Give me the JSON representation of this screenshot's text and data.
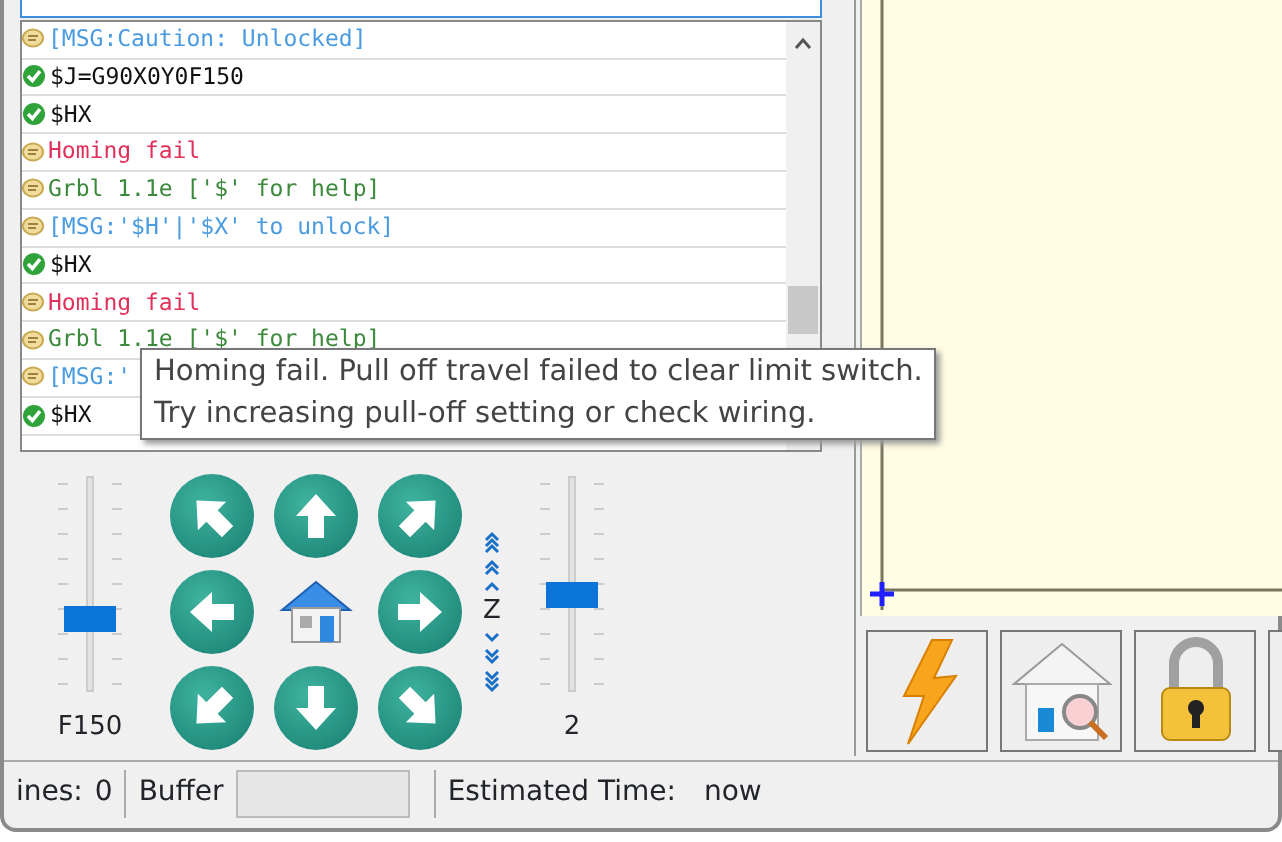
{
  "console": {
    "rows": [
      {
        "kind": "msg",
        "text": "[MSG:Caution: Unlocked]"
      },
      {
        "kind": "ok",
        "text": "$J=G90X0Y0F150"
      },
      {
        "kind": "ok",
        "text": "$HX"
      },
      {
        "kind": "error",
        "text": "Homing fail"
      },
      {
        "kind": "info",
        "text": "Grbl 1.1e ['$' for help]"
      },
      {
        "kind": "msg",
        "text": "[MSG:'$H'|'$X' to unlock]"
      },
      {
        "kind": "ok",
        "text": "$HX"
      },
      {
        "kind": "error",
        "text": "Homing fail"
      },
      {
        "kind": "info",
        "text": "Grbl 1.1e ['$' for help]"
      },
      {
        "kind": "msg",
        "text": "[MSG:'"
      },
      {
        "kind": "ok",
        "text": "$HX"
      }
    ]
  },
  "tooltip": [
    "Homing fail. Pull off travel failed to clear limit switch.",
    "Try increasing pull-off setting or check wiring."
  ],
  "jog": {
    "speed_slider": {
      "level": 0.32,
      "reading": "F150"
    },
    "z_label": "Z",
    "step_slider": {
      "level": 0.45,
      "reading": "2"
    }
  },
  "status_bar": {
    "lines_label": "ines:",
    "lines_value": "0",
    "buffer_label": "Buffer",
    "buffer": {
      "level": 0
    },
    "time_label": "Estimated Time:",
    "time_value": "now"
  }
}
